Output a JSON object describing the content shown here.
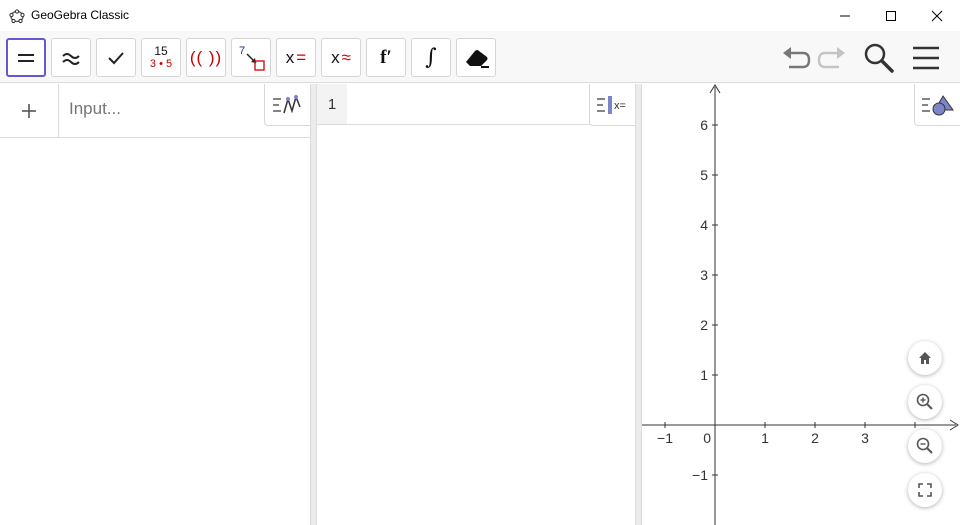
{
  "window": {
    "title": "GeoGebra Classic",
    "controls": {
      "minimize_icon": "minimize-icon",
      "maximize_icon": "maximize-icon",
      "close_icon": "close-icon"
    }
  },
  "toolbar": {
    "tools": [
      {
        "id": "evaluate",
        "icon": "equals-icon",
        "active": true
      },
      {
        "id": "numeric",
        "icon": "approx-icon"
      },
      {
        "id": "keep-input",
        "icon": "checkmark-icon"
      },
      {
        "id": "factor",
        "icon": "factor-icon",
        "top": "15",
        "bottom": "3 • 5"
      },
      {
        "id": "expand",
        "icon": "parentheses-icon",
        "label": "(( ))"
      },
      {
        "id": "substitute",
        "icon": "substitute-icon",
        "label": "7"
      },
      {
        "id": "solve",
        "icon": "solve-icon",
        "label": "x",
        "suffix": "="
      },
      {
        "id": "solve-numerically",
        "icon": "solve-numeric-icon",
        "label": "x",
        "suffix": "≈"
      },
      {
        "id": "derivative",
        "icon": "derivative-icon",
        "label": "f′"
      },
      {
        "id": "integral",
        "icon": "integral-icon",
        "label": "∫"
      },
      {
        "id": "delete",
        "icon": "eraser-icon"
      }
    ],
    "right": [
      "undo-icon",
      "redo-icon",
      "search-icon",
      "menu-icon"
    ]
  },
  "algebra": {
    "add_icon": "plus-icon",
    "input_placeholder": "Input..."
  },
  "cas": {
    "rows": [
      {
        "number": "1",
        "value": ""
      }
    ]
  },
  "graphics": {
    "x_ticks": [
      "−1",
      "0",
      "1",
      "2",
      "3"
    ],
    "y_ticks": [
      "6",
      "5",
      "4",
      "3",
      "2",
      "1",
      "−1"
    ],
    "buttons": [
      "home-icon",
      "zoom-in-icon",
      "zoom-out-icon",
      "fullscreen-icon"
    ]
  },
  "colors": {
    "accent": "#6557d2",
    "red": "#cc0000",
    "navy": "#1a2c8a"
  }
}
